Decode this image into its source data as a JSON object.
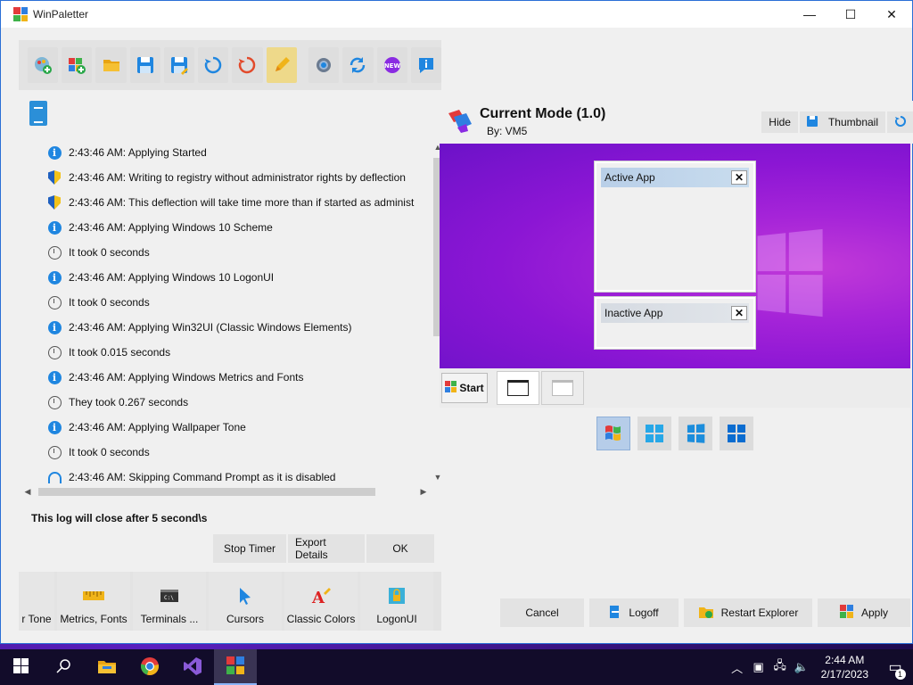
{
  "window": {
    "title": "WinPaletter",
    "minimize": "—",
    "maximize": "☐",
    "close": "✕"
  },
  "toolbar": {
    "buttons": [
      {
        "icon": "palette-add-icon"
      },
      {
        "icon": "windows-add-icon"
      },
      {
        "icon": "folder-open-icon"
      },
      {
        "icon": "save-icon"
      },
      {
        "icon": "save-as-icon"
      },
      {
        "icon": "refresh-icon"
      },
      {
        "icon": "restore-icon"
      },
      {
        "icon": "edit-pencil-icon"
      },
      {
        "icon": "settings-gear-icon"
      },
      {
        "icon": "sync-icon"
      },
      {
        "icon": "new-badge-icon"
      },
      {
        "icon": "info-icon"
      }
    ],
    "new_badge": "NEW"
  },
  "log": {
    "rows": [
      {
        "type": "info",
        "text": "2:43:46 AM: Applying Started"
      },
      {
        "type": "shield",
        "text": "2:43:46 AM: Writing to registry without administrator rights by deflection"
      },
      {
        "type": "shield",
        "text": "2:43:46 AM: This deflection will take time more than if started as administ"
      },
      {
        "type": "info",
        "text": "2:43:46 AM: Applying Windows 10 Scheme"
      },
      {
        "type": "clock",
        "text": "It took 0 seconds"
      },
      {
        "type": "info",
        "text": "2:43:46 AM: Applying Windows 10 LogonUI"
      },
      {
        "type": "clock",
        "text": "It took 0 seconds"
      },
      {
        "type": "info",
        "text": "2:43:46 AM: Applying Win32UI (Classic Windows Elements)"
      },
      {
        "type": "clock",
        "text": "It took 0.015 seconds"
      },
      {
        "type": "info",
        "text": "2:43:46 AM: Applying Windows Metrics and Fonts"
      },
      {
        "type": "clock",
        "text": "They took 0.267 seconds"
      },
      {
        "type": "info",
        "text": "2:43:46 AM: Applying Wallpaper Tone"
      },
      {
        "type": "clock",
        "text": "It took 0 seconds"
      },
      {
        "type": "headphones",
        "text": "2:43:46 AM: Skipping Command Prompt as it is disabled"
      }
    ],
    "note": "This log will close after 5 second\\s",
    "stop_timer": "Stop Timer",
    "export_details": "Export Details",
    "ok": "OK"
  },
  "categories": [
    {
      "label": "r Tone",
      "icon": "",
      "width": 40
    },
    {
      "label": "Metrics, Fonts",
      "icon": "ruler-icon",
      "width": 82
    },
    {
      "label": "Terminals ...",
      "icon": "terminal-icon",
      "width": 82
    },
    {
      "label": "Cursors",
      "icon": "cursor-icon",
      "width": 82
    },
    {
      "label": "Classic Colors",
      "icon": "classic-colors-icon",
      "width": 82
    },
    {
      "label": "LogonUI",
      "icon": "lock-icon",
      "width": 82
    }
  ],
  "terminal_glyph": "C:\\",
  "mode": {
    "title": "Current Mode (1.0)",
    "author": "By: VM5",
    "hide": "Hide",
    "thumbnail": "Thumbnail"
  },
  "preview": {
    "active_app": "Active App",
    "inactive_app": "Inactive App",
    "close_glyph": "✕",
    "start": "Start"
  },
  "actions": {
    "cancel": "Cancel",
    "logoff": "Logoff",
    "restart_explorer": "Restart Explorer",
    "apply": "Apply"
  },
  "os_taskbar": {
    "time": "2:44 AM",
    "date": "2/17/2023",
    "notifications": "1"
  },
  "colors": {
    "accent": "#1f86e0",
    "preview_bg": "#8b16d4",
    "taskbar": "#120c2a"
  }
}
